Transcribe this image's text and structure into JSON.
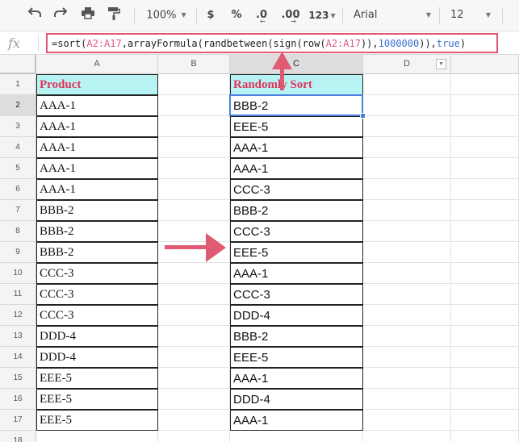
{
  "toolbar": {
    "zoom": "100%",
    "currency": "$",
    "percent": "%",
    "decimal_decrease": ".0",
    "decimal_increase": ".00",
    "number_format": "123",
    "font": "Arial",
    "font_size": "12"
  },
  "formula_bar": {
    "fx_label": "fx",
    "parts": [
      {
        "text": "=sort(",
        "kind": "plain"
      },
      {
        "text": "A2:A17",
        "kind": "ref"
      },
      {
        "text": ",arrayFormula(randbetween(sign(row(",
        "kind": "plain"
      },
      {
        "text": "A2:A17",
        "kind": "ref"
      },
      {
        "text": ")),",
        "kind": "plain"
      },
      {
        "text": "1000000",
        "kind": "num"
      },
      {
        "text": ")),",
        "kind": "plain"
      },
      {
        "text": "true",
        "kind": "num"
      },
      {
        "text": ")",
        "kind": "plain"
      }
    ]
  },
  "columns": [
    "A",
    "B",
    "C",
    "D"
  ],
  "rows": [
    "1",
    "2",
    "3",
    "4",
    "5",
    "6",
    "7",
    "8",
    "9",
    "10",
    "11",
    "12",
    "13",
    "14",
    "15",
    "16",
    "17",
    "18"
  ],
  "column_a": {
    "header": "Product",
    "values": [
      "AAA-1",
      "AAA-1",
      "AAA-1",
      "AAA-1",
      "AAA-1",
      "BBB-2",
      "BBB-2",
      "BBB-2",
      "CCC-3",
      "CCC-3",
      "CCC-3",
      "DDD-4",
      "DDD-4",
      "EEE-5",
      "EEE-5",
      "EEE-5"
    ]
  },
  "column_c": {
    "header": "Randomly Sort",
    "values": [
      "BBB-2",
      "EEE-5",
      "AAA-1",
      "AAA-1",
      "CCC-3",
      "BBB-2",
      "CCC-3",
      "EEE-5",
      "AAA-1",
      "CCC-3",
      "DDD-4",
      "BBB-2",
      "EEE-5",
      "AAA-1",
      "DDD-4",
      "AAA-1"
    ]
  },
  "colors": {
    "formula_ref": "#e3567b",
    "formula_number": "#3a6fd1",
    "arrow": "#e05a74",
    "header_fill": "#b8f3f3",
    "header_text": "#e0355a",
    "selection": "#4a7fe0"
  },
  "icons": [
    "undo-icon",
    "redo-icon",
    "print-icon",
    "paint-format-icon",
    "arrow-up-icon",
    "arrow-right-icon"
  ]
}
